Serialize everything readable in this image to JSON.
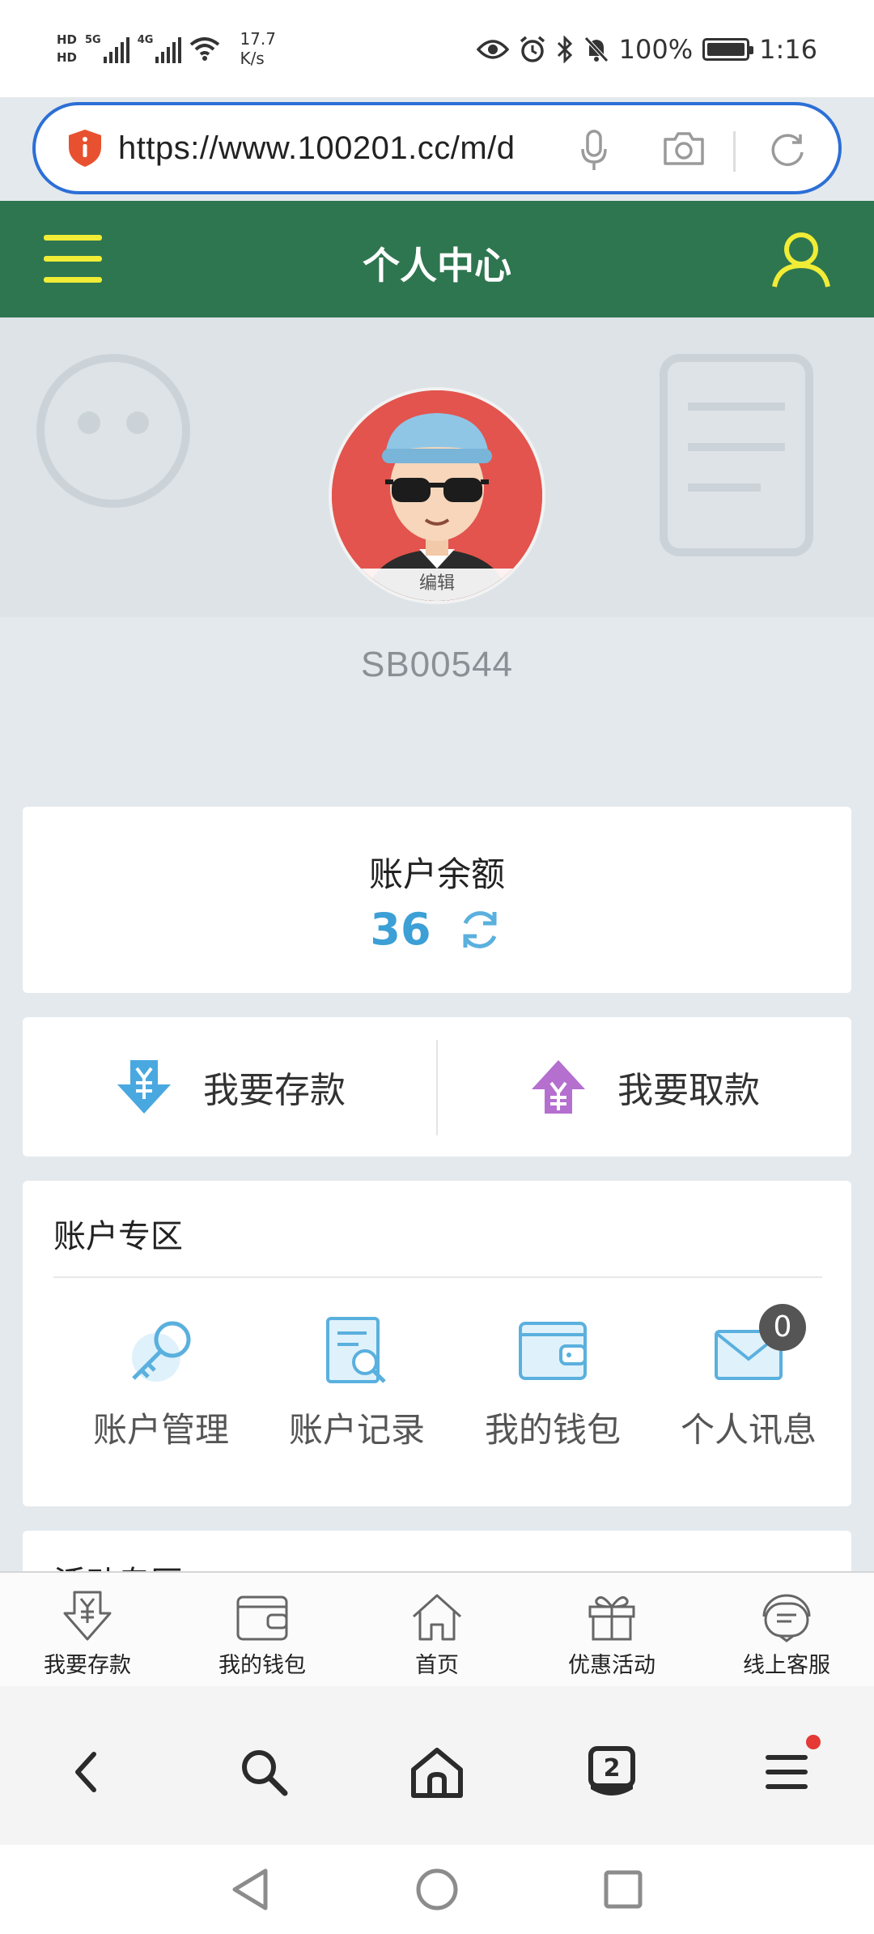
{
  "status_bar": {
    "hd1": "HD",
    "hd2": "HD",
    "net1": "5G",
    "net2": "4G",
    "speed_value": "17.7",
    "speed_unit": "K/s",
    "battery": "100%",
    "time": "1:16"
  },
  "browser": {
    "url": "https://www.100201.cc/m/d"
  },
  "header": {
    "title": "个人中心"
  },
  "profile": {
    "edit_label": "编辑",
    "username": "SB00544"
  },
  "balance": {
    "label": "账户余额",
    "value": "36"
  },
  "actions": {
    "deposit": "我要存款",
    "withdraw": "我要取款"
  },
  "account_zone": {
    "title": "账户专区",
    "items": [
      {
        "label": "账户管理",
        "icon": "key-icon"
      },
      {
        "label": "账户记录",
        "icon": "record-search-icon"
      },
      {
        "label": "我的钱包",
        "icon": "wallet-icon"
      },
      {
        "label": "个人讯息",
        "icon": "mail-icon",
        "badge": "0"
      }
    ]
  },
  "activity_zone": {
    "title": "活动专区"
  },
  "tabs": [
    {
      "label": "我要存款",
      "icon": "deposit-icon"
    },
    {
      "label": "我的钱包",
      "icon": "wallet-icon"
    },
    {
      "label": "首页",
      "icon": "home-icon"
    },
    {
      "label": "优惠活动",
      "icon": "gift-icon"
    },
    {
      "label": "线上客服",
      "icon": "support-icon"
    }
  ],
  "browser_nav": {
    "tab_count": "2"
  },
  "colors": {
    "header_green": "#2e7650",
    "accent_yellow": "#f1ec36",
    "balance_blue": "#3c9fd6",
    "url_border": "#2c6fd6"
  }
}
